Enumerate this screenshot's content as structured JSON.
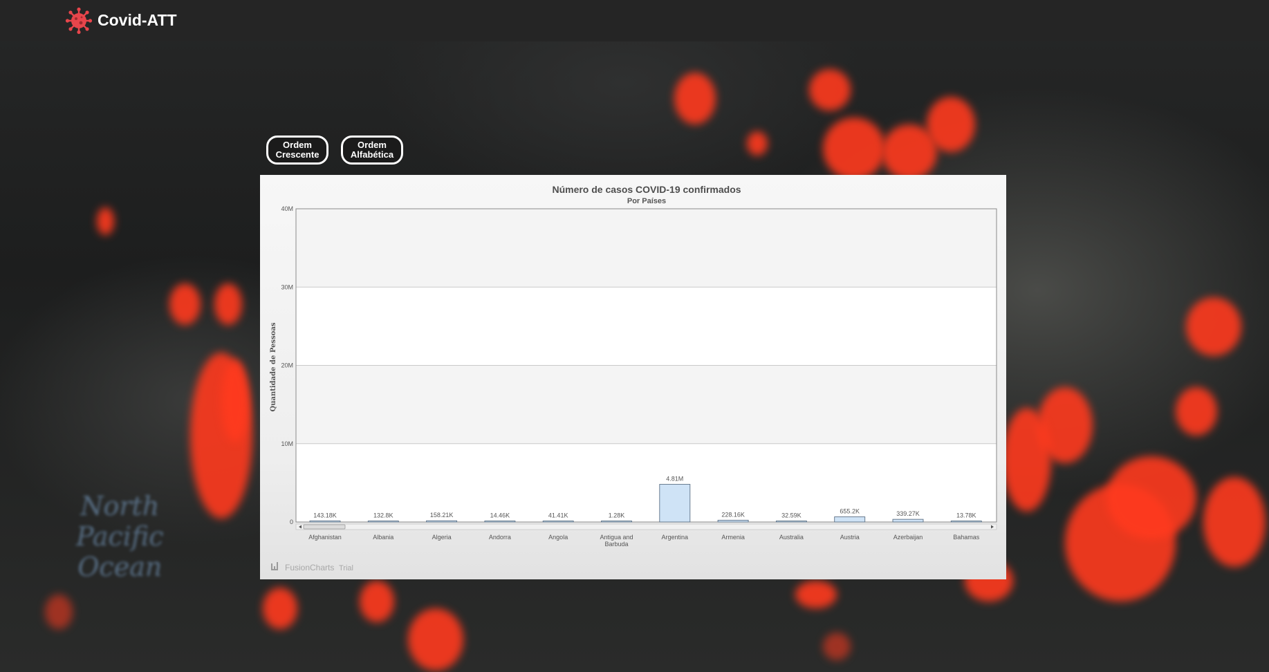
{
  "app": {
    "title": "Covid-ATT",
    "logo_icon": "virus-icon",
    "accent_color": "#e8454b"
  },
  "sort_buttons": [
    {
      "line1": "Ordem",
      "line2": "Crescente"
    },
    {
      "line1": "Ordem",
      "line2": "Alfabética"
    }
  ],
  "chart_data": {
    "type": "bar",
    "title": "Número de casos COVID-19 confirmados",
    "subtitle": "Por Países",
    "xlabel": "",
    "ylabel": "Quantidade de Pessoas",
    "ylim": [
      0,
      40000000
    ],
    "yticks": [
      {
        "value": 0,
        "label": "0"
      },
      {
        "value": 10000000,
        "label": "10M"
      },
      {
        "value": 20000000,
        "label": "20M"
      },
      {
        "value": 30000000,
        "label": "30M"
      },
      {
        "value": 40000000,
        "label": "40M"
      }
    ],
    "categories": [
      "Afghanistan",
      "Albania",
      "Algeria",
      "Andorra",
      "Angola",
      "Antigua and Barbuda",
      "Argentina",
      "Armenia",
      "Australia",
      "Austria",
      "Azerbaijan",
      "Bahamas"
    ],
    "values": [
      143180,
      132800,
      158210,
      14460,
      41410,
      1280,
      4810000,
      228160,
      32590,
      655200,
      339270,
      13780
    ],
    "value_labels": [
      "143.18K",
      "132.8K",
      "158.21K",
      "14.46K",
      "41.41K",
      "1.28K",
      "4.81M",
      "228.16K",
      "32.59K",
      "655.2K",
      "339.27K",
      "13.78K"
    ],
    "grid": true,
    "alternate_bands": true,
    "scrollable": true,
    "bar_color": "#cfe3f6",
    "bar_border": "#5b6f84",
    "watermark": "FusionCharts",
    "watermark_suffix": "Trial"
  }
}
